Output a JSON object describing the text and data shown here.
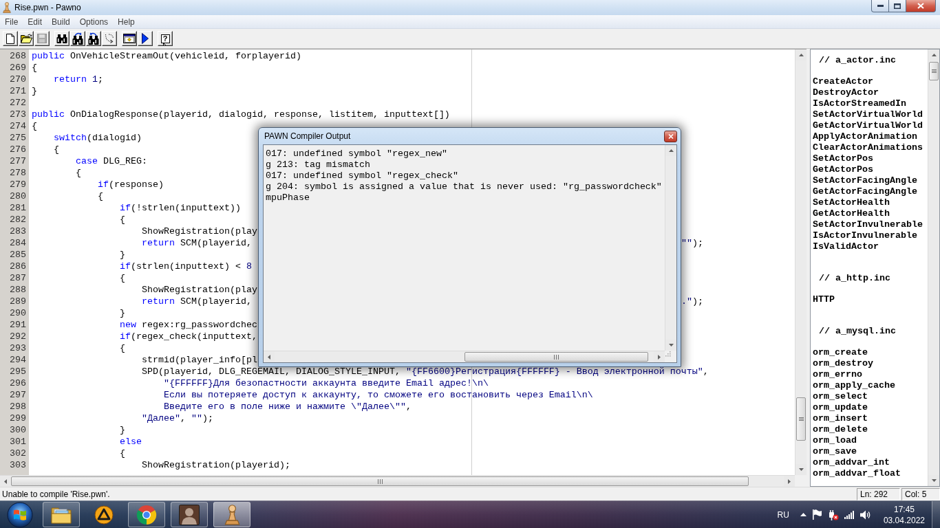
{
  "window": {
    "title": "Rise.pwn - Pawno"
  },
  "menu": [
    "File",
    "Edit",
    "Build",
    "Options",
    "Help"
  ],
  "toolbar": {
    "groups": [
      {
        "buttons": [
          {
            "kind": "new",
            "disabled": false
          },
          {
            "kind": "open",
            "disabled": false
          },
          {
            "kind": "save",
            "disabled": true
          }
        ]
      },
      {
        "buttons": [
          {
            "kind": "find",
            "disabled": false
          },
          {
            "kind": "find_forward",
            "disabled": false
          },
          {
            "kind": "find_backward",
            "disabled": false
          },
          {
            "kind": "replace",
            "disabled": false
          }
        ]
      },
      {
        "buttons": [
          {
            "kind": "compile",
            "disabled": false
          },
          {
            "kind": "run",
            "disabled": false
          }
        ]
      },
      {
        "buttons": [
          {
            "kind": "help",
            "disabled": false,
            "label": "?"
          }
        ]
      }
    ]
  },
  "editor": {
    "lines": [
      {
        "number": "268",
        "segments": [
          {
            "kind": "keyword",
            "text": "public"
          },
          {
            "kind": "plain",
            "text": " OnVehicleStreamOut(vehicleid, forplayerid)"
          }
        ]
      },
      {
        "number": "269",
        "segments": [
          {
            "kind": "plain",
            "text": "{"
          }
        ]
      },
      {
        "number": "270",
        "segments": [
          {
            "kind": "keyword",
            "text": "    return "
          },
          {
            "kind": "number",
            "text": "1"
          },
          {
            "kind": "plain",
            "text": ";"
          }
        ]
      },
      {
        "number": "271",
        "segments": [
          {
            "kind": "plain",
            "text": "}"
          }
        ]
      },
      {
        "number": "272"
      },
      {
        "number": "273",
        "segments": [
          {
            "kind": "keyword",
            "text": "public"
          },
          {
            "kind": "plain",
            "text": " OnDialogResponse(playerid, dialogid, response, listitem, inputtext[])"
          }
        ]
      },
      {
        "number": "274",
        "segments": [
          {
            "kind": "plain",
            "text": "{"
          }
        ]
      },
      {
        "number": "275",
        "segments": [
          {
            "kind": "keyword",
            "text": "    switch"
          },
          {
            "kind": "plain",
            "text": "(dialogid)"
          }
        ]
      },
      {
        "number": "276",
        "segments": [
          {
            "kind": "plain",
            "text": "    {"
          }
        ]
      },
      {
        "number": "277",
        "segments": [
          {
            "kind": "keyword",
            "text": "        case"
          },
          {
            "kind": "plain",
            "text": " DLG_REG:"
          }
        ]
      },
      {
        "number": "278",
        "segments": [
          {
            "kind": "plain",
            "text": "        {"
          }
        ]
      },
      {
        "number": "279",
        "segments": [
          {
            "kind": "keyword",
            "text": "            if"
          },
          {
            "kind": "plain",
            "text": "(response)"
          }
        ]
      },
      {
        "number": "280",
        "segments": [
          {
            "kind": "plain",
            "text": "            {"
          }
        ]
      },
      {
        "number": "281",
        "segments": [
          {
            "kind": "keyword",
            "text": "                if"
          },
          {
            "kind": "plain",
            "text": "(!strlen(inputtext))"
          }
        ]
      },
      {
        "number": "282",
        "segments": [
          {
            "kind": "plain",
            "text": "                {"
          }
        ]
      },
      {
        "number": "283",
        "segments": [
          {
            "kind": "plain",
            "text": "                    ShowRegistration(play"
          }
        ]
      },
      {
        "number": "284",
        "segments": [
          {
            "kind": "keyword",
            "text": "                    return"
          },
          {
            "kind": "plain",
            "text": " SCM(playerid,"
          }
        ],
        "tail": [
          {
            "kind": "string",
            "text": "\"\""
          },
          {
            "kind": "plain",
            "text": ");"
          }
        ]
      },
      {
        "number": "285",
        "segments": [
          {
            "kind": "plain",
            "text": "                }"
          }
        ]
      },
      {
        "number": "286",
        "segments": [
          {
            "kind": "keyword",
            "text": "                if"
          },
          {
            "kind": "plain",
            "text": "(strlen(inputtext) < "
          },
          {
            "kind": "number",
            "text": "8"
          }
        ]
      },
      {
        "number": "287",
        "segments": [
          {
            "kind": "plain",
            "text": "                {"
          }
        ]
      },
      {
        "number": "288",
        "segments": [
          {
            "kind": "plain",
            "text": "                    ShowRegistration(play"
          }
        ]
      },
      {
        "number": "289",
        "segments": [
          {
            "kind": "keyword",
            "text": "                    return"
          },
          {
            "kind": "plain",
            "text": " SCM(playerid,"
          }
        ],
        "tail": [
          {
            "kind": "string",
            "text": ".\""
          },
          {
            "kind": "plain",
            "text": ");"
          }
        ]
      },
      {
        "number": "290",
        "segments": [
          {
            "kind": "plain",
            "text": "                }"
          }
        ]
      },
      {
        "number": "291",
        "segments": [
          {
            "kind": "keyword",
            "text": "                new"
          },
          {
            "kind": "plain",
            "text": " regex:rg_passwordchec"
          }
        ]
      },
      {
        "number": "292",
        "segments": [
          {
            "kind": "keyword",
            "text": "                if"
          },
          {
            "kind": "plain",
            "text": "(regex_check(inputtext,"
          }
        ]
      },
      {
        "number": "293",
        "segments": [
          {
            "kind": "plain",
            "text": "                {"
          }
        ]
      },
      {
        "number": "294",
        "segments": [
          {
            "kind": "plain",
            "text": "                    strmid(player_info[pl"
          }
        ]
      },
      {
        "number": "295",
        "segments": [
          {
            "kind": "plain",
            "text": "                    SPD(playerid, DLG_REGEMAIL, DIALOG_STYLE_INPUT, "
          },
          {
            "kind": "string",
            "text": "\"{FF6600}Регистрация{FFFFFF} - Ввод электронной почты\""
          },
          {
            "kind": "plain",
            "text": ","
          }
        ]
      },
      {
        "number": "296",
        "segments": [
          {
            "kind": "string",
            "text": "                        \"{FFFFFF}Для безопастности аккаунта введите Email адрес!\\n\\"
          }
        ]
      },
      {
        "number": "297",
        "segments": [
          {
            "kind": "string",
            "text": "                        Если вы потеряете доступ к аккаунту, то сможете его востановить через Email\\n\\"
          }
        ]
      },
      {
        "number": "298",
        "segments": [
          {
            "kind": "string",
            "text": "                        Введите его в поле ниже и нажмите \\\"Далее\\\"\""
          },
          {
            "kind": "plain",
            "text": ","
          }
        ]
      },
      {
        "number": "299",
        "segments": [
          {
            "kind": "string",
            "text": "                    \"Далее\""
          },
          {
            "kind": "plain",
            "text": ", "
          },
          {
            "kind": "string",
            "text": "\"\""
          },
          {
            "kind": "plain",
            "text": ");"
          }
        ]
      },
      {
        "number": "300",
        "segments": [
          {
            "kind": "plain",
            "text": "                }"
          }
        ]
      },
      {
        "number": "301",
        "segments": [
          {
            "kind": "keyword",
            "text": "                else"
          }
        ]
      },
      {
        "number": "302",
        "segments": [
          {
            "kind": "plain",
            "text": "                {"
          }
        ]
      },
      {
        "number": "303",
        "segments": [
          {
            "kind": "plain",
            "text": "                    ShowRegistration(playerid);"
          }
        ]
      }
    ]
  },
  "compiler_output": {
    "title": "PAWN Compiler Output",
    "lines": [
      "017: undefined symbol \"regex_new\"",
      "g 213: tag mismatch",
      "017: undefined symbol \"regex_check\"",
      "g 204: symbol is assigned a value that is never used: \"rg_passwordcheck\"",
      "mpuPhase"
    ]
  },
  "function_list": {
    "groups": [
      {
        "header": "// a_actor.inc",
        "items": [
          "CreateActor",
          "DestroyActor",
          "IsActorStreamedIn",
          "SetActorVirtualWorld",
          "GetActorVirtualWorld",
          "ApplyActorAnimation",
          "ClearActorAnimations",
          "SetActorPos",
          "GetActorPos",
          "SetActorFacingAngle",
          "GetActorFacingAngle",
          "SetActorHealth",
          "GetActorHealth",
          "SetActorInvulnerable",
          "IsActorInvulnerable",
          "IsValidActor"
        ]
      },
      {
        "header": "// a_http.inc",
        "items": [
          "HTTP"
        ]
      },
      {
        "header": "// a_mysql.inc",
        "items": [
          "orm_create",
          "orm_destroy",
          "orm_errno",
          "orm_apply_cache",
          "orm_select",
          "orm_update",
          "orm_insert",
          "orm_delete",
          "orm_load",
          "orm_save",
          "orm_addvar_int",
          "orm_addvar_float"
        ]
      }
    ]
  },
  "status_bar": {
    "message": "Unable to compile 'Rise.pwn'.",
    "position": [
      "Ln: 292",
      "Col: 5"
    ]
  },
  "taskbar": {
    "apps": [
      {
        "kind": "folder",
        "running": true,
        "selected": false
      },
      {
        "kind": "player",
        "running": false,
        "selected": false
      },
      {
        "kind": "browser",
        "running": true,
        "selected": false
      },
      {
        "kind": "game",
        "running": true,
        "selected": false
      },
      {
        "kind": "pawn",
        "running": true,
        "selected": true
      }
    ],
    "language": "RU",
    "time": "17:45",
    "date": "03.04.2022"
  }
}
